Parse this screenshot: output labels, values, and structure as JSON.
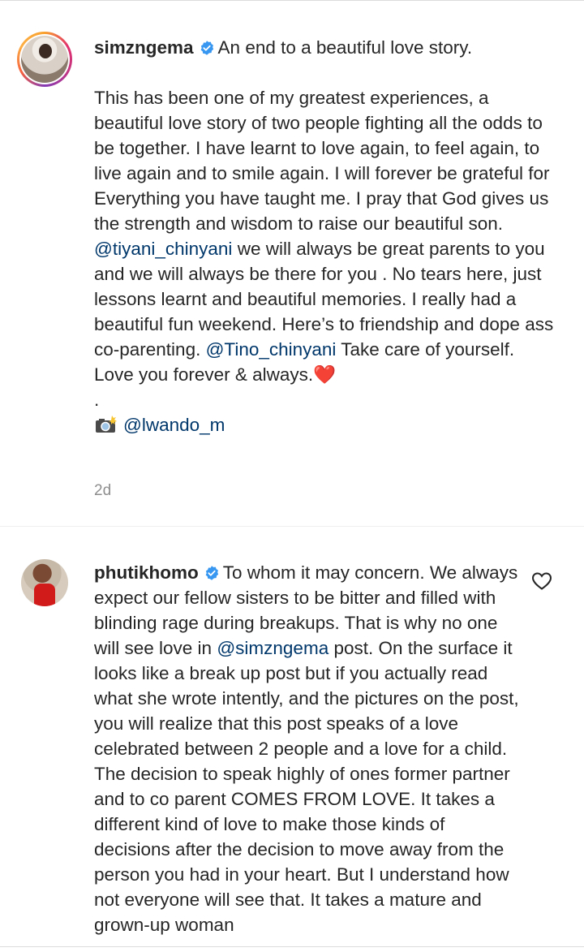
{
  "caption": {
    "username": "simzngema",
    "opening": "An end to a beautiful love story.",
    "body_part1": "This has been one of my greatest experiences, a beautiful love story of two people fighting all the odds to be together. I have learnt to love again, to feel again, to live again and to smile again. I will forever be grateful for Everything you have taught me. I pray that God gives us the strength and wisdom to raise our beautiful son. ",
    "mention1": "@tiyani_chinyani",
    "body_part2": " we will always be great parents to you and we will always be there for you . No tears here, just lessons learnt and beautiful memories. I really had a beautiful fun weekend. Here’s to friendship and dope ass co-parenting. ",
    "mention2": "@Tino_chinyani",
    "body_part3": " Take care of yourself. Love you forever & always.",
    "heart": "❤️",
    "dot": ".",
    "credit_mention": "@lwando_m",
    "timestamp": "2d"
  },
  "comment": {
    "username": "phutikhomo",
    "part1": "To whom it may concern. We always expect our fellow sisters to be bitter and filled with blinding rage during breakups. That is why no one will see love in ",
    "mention": "@simzngema",
    "part2": " post. On the surface it looks like a break up post but if you actually read what she wrote intently, and the pictures on the post, you will realize that this post speaks of a love celebrated between 2 people and a love for a child. The decision to speak highly of ones former partner and to co parent COMES FROM LOVE. It takes a different kind of love to make those kinds of decisions after the decision to move away from the person you had in your heart. But I understand how not everyone will see that. It takes a mature and grown-up woman"
  },
  "icons": {
    "verified": "verified-badge-icon",
    "like": "heart-outline-icon",
    "camera": "camera-flash-icon"
  },
  "colors": {
    "text": "#262626",
    "mention": "#00376b",
    "verified": "#3897f0",
    "muted": "#8e8e8e"
  }
}
